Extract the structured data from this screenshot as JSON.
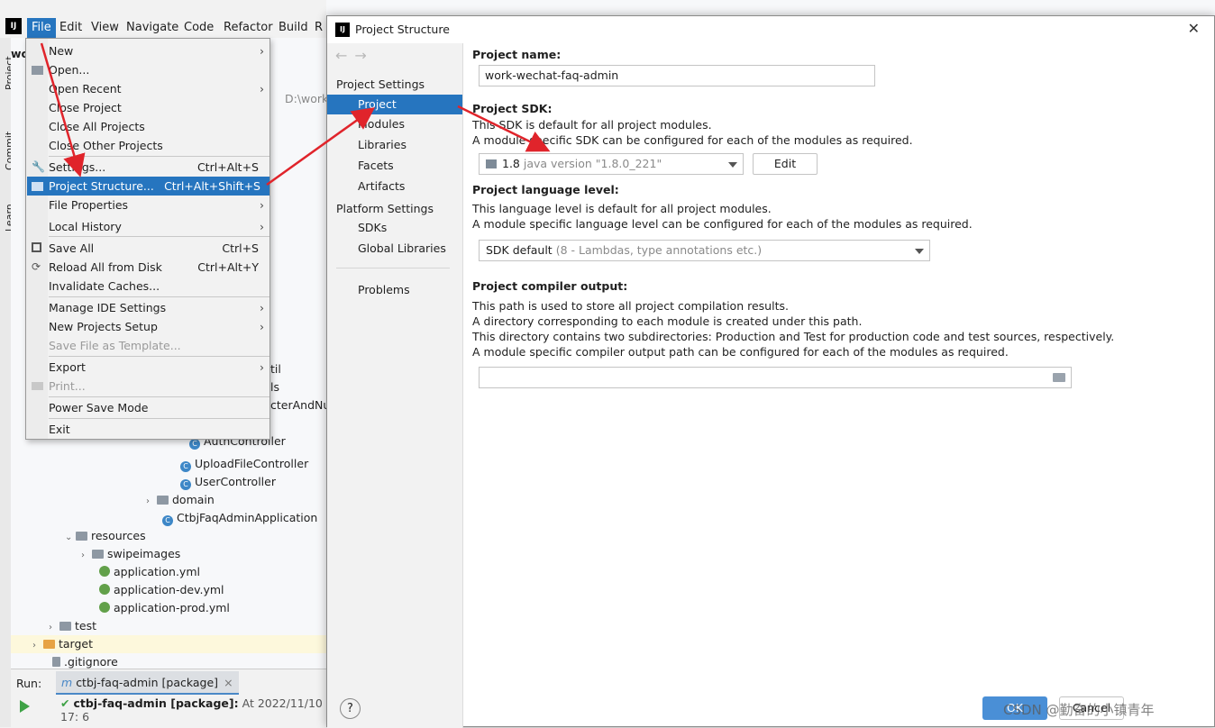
{
  "menubar": {
    "logo": "IJ",
    "items": [
      "File",
      "Edit",
      "View",
      "Navigate",
      "Code",
      "Refactor",
      "Build",
      "R"
    ]
  },
  "side_tabs": [
    "Project",
    "Commit",
    "Learn"
  ],
  "file_menu": {
    "items": [
      {
        "label": "New",
        "shortcut": "",
        "submenu": true
      },
      {
        "label": "Open...",
        "shortcut": "",
        "submenu": false
      },
      {
        "label": "Open Recent",
        "shortcut": "",
        "submenu": true
      },
      {
        "label": "Close Project",
        "shortcut": "",
        "submenu": false
      },
      {
        "label": "Close All Projects",
        "shortcut": "",
        "submenu": false
      },
      {
        "label": "Close Other Projects",
        "shortcut": "",
        "submenu": false
      },
      {
        "label": "Settings...",
        "shortcut": "Ctrl+Alt+S",
        "submenu": false
      },
      {
        "label": "Project Structure...",
        "shortcut": "Ctrl+Alt+Shift+S",
        "submenu": false
      },
      {
        "label": "File Properties",
        "shortcut": "",
        "submenu": true
      },
      {
        "label": "Local History",
        "shortcut": "",
        "submenu": true
      },
      {
        "label": "Save All",
        "shortcut": "Ctrl+S",
        "submenu": false
      },
      {
        "label": "Reload All from Disk",
        "shortcut": "Ctrl+Alt+Y",
        "submenu": false
      },
      {
        "label": "Invalidate Caches...",
        "shortcut": "",
        "submenu": false
      },
      {
        "label": "Manage IDE Settings",
        "shortcut": "",
        "submenu": true
      },
      {
        "label": "New Projects Setup",
        "shortcut": "",
        "submenu": true
      },
      {
        "label": "Save File as Template...",
        "shortcut": "",
        "submenu": false
      },
      {
        "label": "Export",
        "shortcut": "",
        "submenu": true
      },
      {
        "label": "Print...",
        "shortcut": "",
        "submenu": false
      },
      {
        "label": "Power Save Mode",
        "shortcut": "",
        "submenu": false
      },
      {
        "label": "Exit",
        "shortcut": "",
        "submenu": false
      }
    ]
  },
  "tree": {
    "header_fragment": "wo",
    "path_fragment": "D:\\work",
    "partial": [
      "til",
      "ls",
      "cterAndNu"
    ],
    "items": [
      "AuthController",
      "UploadFileController",
      "UserController",
      "domain",
      "CtbjFaqAdminApplication",
      "resources",
      "swipeimages",
      "application.yml",
      "application-dev.yml",
      "application-prod.yml",
      "test",
      "target",
      ".gitignore"
    ]
  },
  "run": {
    "label": "Run:",
    "tab": "ctbj-faq-admin [package]",
    "result_name": "ctbj-faq-admin [package]:",
    "result_time": "At 2022/11/10 17: 6"
  },
  "dialog": {
    "title": "Project Structure",
    "nav": {
      "project_settings": "Project Settings",
      "project_items": [
        "Project",
        "Modules",
        "Libraries",
        "Facets",
        "Artifacts"
      ],
      "platform_settings": "Platform Settings",
      "platform_items": [
        "SDKs",
        "Global Libraries"
      ],
      "problems": "Problems"
    },
    "project_name_label": "Project name:",
    "project_name_value": "work-wechat-faq-admin",
    "sdk_label": "Project SDK:",
    "sdk_desc1": "This SDK is default for all project modules.",
    "sdk_desc2": "A module specific SDK can be configured for each of the modules as required.",
    "sdk_value": "1.8",
    "sdk_version": "java version \"1.8.0_221\"",
    "edit_button": "Edit",
    "lang_label": "Project language level:",
    "lang_desc1": "This language level is default for all project modules.",
    "lang_desc2": "A module specific language level can be configured for each of the modules as required.",
    "lang_value": "SDK default",
    "lang_detail": "(8 - Lambdas, type annotations etc.)",
    "output_label": "Project compiler output:",
    "output_desc1": "This path is used to store all project compilation results.",
    "output_desc2": "A directory corresponding to each module is created under this path.",
    "output_desc3": "This directory contains two subdirectories: Production and Test for production code and test sources, respectively.",
    "output_desc4": "A module specific compiler output path can be configured for each of the modules as required.",
    "output_value": "",
    "help_button": "?",
    "ok_button": "OK",
    "cancel_button": "Cancel",
    "watermark": "CSDN @勤奋的小镇青年"
  },
  "colors": {
    "selection": "#2675bf",
    "annotation_arrow": "#e0242b"
  }
}
